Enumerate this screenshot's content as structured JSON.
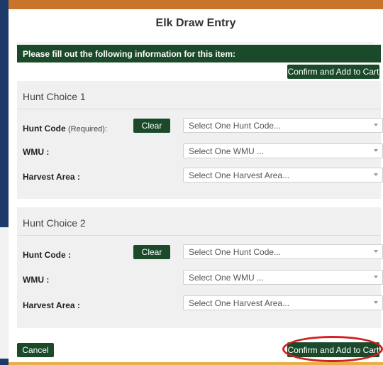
{
  "modal": {
    "title": "Elk Draw Entry",
    "instructions": "Please fill out the following information for this item:",
    "confirm_label": "Confirm and Add to Cart",
    "cancel_label": "Cancel"
  },
  "hunt_choice_1": {
    "title": "Hunt Choice 1",
    "hunt_code_label": "Hunt Code",
    "required_label": "(Required):",
    "clear_label": "Clear",
    "hunt_code_placeholder": "Select One Hunt Code...",
    "wmu_label": "WMU :",
    "wmu_placeholder": "Select One WMU ...",
    "harvest_label": "Harvest Area :",
    "harvest_placeholder": "Select One Harvest Area..."
  },
  "hunt_choice_2": {
    "title": "Hunt Choice 2",
    "hunt_code_label": "Hunt Code :",
    "clear_label": "Clear",
    "hunt_code_placeholder": "Select One Hunt Code...",
    "wmu_label": "WMU :",
    "wmu_placeholder": "Select One WMU ...",
    "harvest_label": "Harvest Area :",
    "harvest_placeholder": "Select One Harvest Area..."
  },
  "colors": {
    "green": "#1a4a2a",
    "orange": "#c8742a",
    "highlight": "#d21f1f"
  }
}
